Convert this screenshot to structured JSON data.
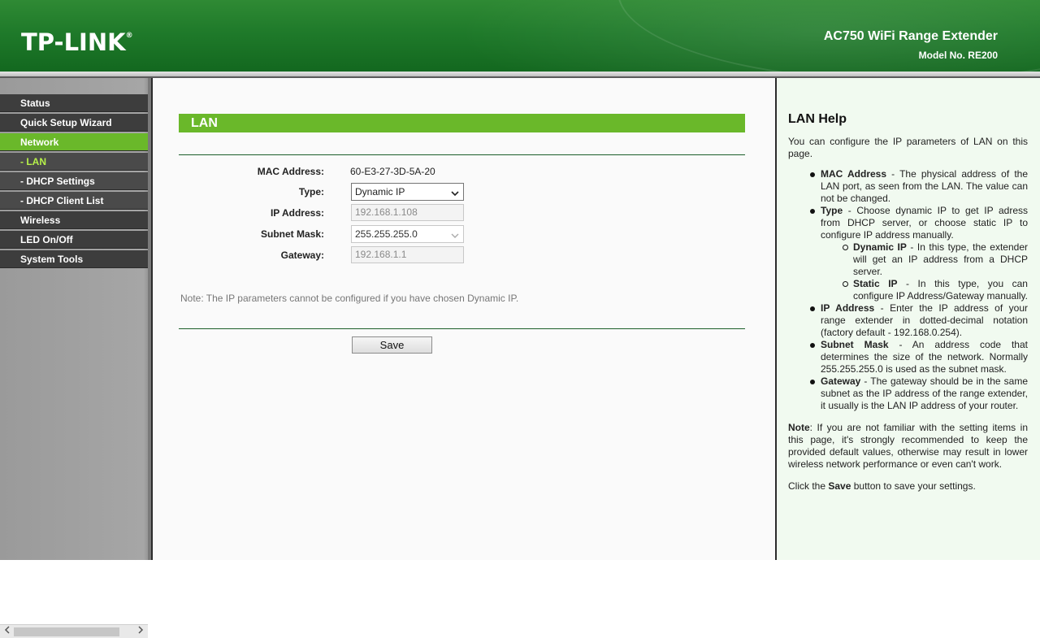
{
  "header": {
    "logo": "TP-LINK",
    "logo_mark": "®",
    "product": "AC750 WiFi Range Extender",
    "model": "Model No. RE200"
  },
  "sidebar": {
    "items": [
      {
        "label": "Status"
      },
      {
        "label": "Quick Setup Wizard"
      },
      {
        "label": "Network"
      },
      {
        "label": "- LAN"
      },
      {
        "label": "- DHCP Settings"
      },
      {
        "label": "- DHCP Client List"
      },
      {
        "label": "Wireless"
      },
      {
        "label": "LED On/Off"
      },
      {
        "label": "System Tools"
      }
    ],
    "active": "Network",
    "current_sub": "- LAN"
  },
  "main": {
    "title": "LAN",
    "mac_label": "MAC Address:",
    "mac_value": "60-E3-27-3D-5A-20",
    "type_label": "Type:",
    "type_value": "Dynamic IP",
    "ip_label": "IP Address:",
    "ip_value": "192.168.1.108",
    "mask_label": "Subnet Mask:",
    "mask_value": "255.255.255.0",
    "gateway_label": "Gateway:",
    "gateway_value": "192.168.1.1",
    "note": "Note: The IP parameters cannot be configured if you have chosen Dynamic IP.",
    "save_label": "Save"
  },
  "help": {
    "title": "LAN Help",
    "intro": "You can configure the IP parameters of LAN on this page.",
    "mac_term": "MAC Address",
    "mac_text": " - The physical address of the LAN port, as seen from the LAN. The value can not be changed.",
    "type_term": "Type",
    "type_text": " - Choose dynamic IP to get IP adress from DHCP server, or choose static IP to configure IP address manually.",
    "dyn_term": "Dynamic IP",
    "dyn_text": " - In this type, the extender will get an IP address from a DHCP server.",
    "static_term": "Static IP",
    "static_text": " - In this type, you can configure IP Address/Gateway manually.",
    "ip_term": "IP Address",
    "ip_text": " - Enter the IP address of your range extender in dotted-decimal notation (factory default - 192.168.0.254).",
    "mask_term": "Subnet Mask",
    "mask_text": " - An address code that determines the size of the network. Normally 255.255.255.0 is used as the subnet mask.",
    "gw_term": "Gateway",
    "gw_text": " - The gateway should be in the same subnet as the IP address of the range extender, it usually is the LAN IP address of your router.",
    "note_term": "Note",
    "note_text": ": If you are not familiar with the setting items in this page, it's strongly recommended to keep the provided default values, otherwise may result in lower wireless network performance or even can't work.",
    "click_pre": "Click the ",
    "click_term": "Save",
    "click_post": " button to save your settings."
  },
  "colors": {
    "brand_green": "#1f7a2a",
    "accent_green": "#6ab82a",
    "menu_dark": "#3d3d3d"
  },
  "icons": [
    "chevron-down-icon",
    "chevron-left-icon",
    "chevron-right-icon"
  ]
}
